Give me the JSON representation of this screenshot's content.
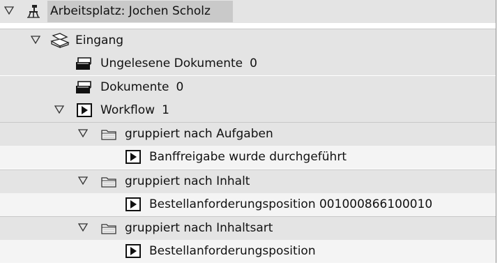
{
  "tree": {
    "workplace": {
      "label": "Arbeitsplatz: Jochen Scholz",
      "icon": "desk-chair-icon",
      "expanded": true
    },
    "inbox": {
      "label": "Eingang",
      "icon": "inbox-tray-icon",
      "expanded": true
    },
    "unread_documents": {
      "label": "Ungelesene Dokumente",
      "count": "0",
      "icon": "document-tray-icon"
    },
    "documents": {
      "label": "Dokumente",
      "count": "0",
      "icon": "document-tray-icon"
    },
    "workflow": {
      "label": "Workflow",
      "count": "1",
      "icon": "play-square-icon",
      "expanded": true
    },
    "group_tasks": {
      "label": "gruppiert nach Aufgaben",
      "icon": "folder-icon",
      "expanded": true,
      "item": "Banffreigabe wurde durchgeführt"
    },
    "group_content": {
      "label": "gruppiert nach Inhalt",
      "icon": "folder-icon",
      "expanded": true,
      "item": "Bestellanforderungsposition 001000866100010"
    },
    "group_content_type": {
      "label": "gruppiert nach Inhaltsart",
      "icon": "folder-icon",
      "expanded": true,
      "item": "Bestellanforderungsposition"
    }
  },
  "colors": {
    "row_bg": "#e4e4e4",
    "row_bg_light": "#f4f4f4",
    "selection": "#c9c9c9",
    "text": "#111111"
  }
}
